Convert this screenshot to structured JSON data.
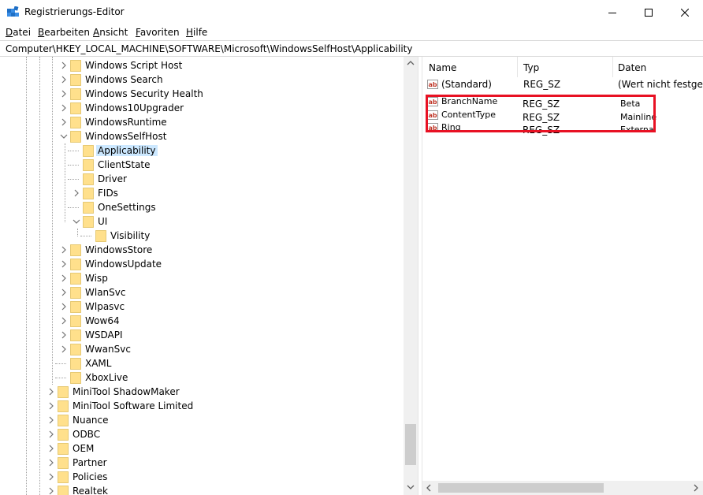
{
  "window": {
    "title": "Registrierungs-Editor"
  },
  "menu": {
    "items": [
      {
        "label": "Datei",
        "mnemonic": "D",
        "rest": "atei"
      },
      {
        "label": "Bearbeiten",
        "mnemonic": "B",
        "rest": "earbeiten"
      },
      {
        "label": "Ansicht",
        "mnemonic": "A",
        "rest": "nsicht"
      },
      {
        "label": "Favoriten",
        "mnemonic": "F",
        "rest": "avoriten"
      },
      {
        "label": "Hilfe",
        "mnemonic": "H",
        "rest": "ilfe"
      }
    ]
  },
  "address": {
    "path": "Computer\\HKEY_LOCAL_MACHINE\\SOFTWARE\\Microsoft\\WindowsSelfHost\\Applicability"
  },
  "tree": {
    "items": [
      {
        "label": "Windows Script Host",
        "expandable": true,
        "expanded": false,
        "level": 1
      },
      {
        "label": "Windows Search",
        "expandable": true,
        "expanded": false,
        "level": 1
      },
      {
        "label": "Windows Security Health",
        "expandable": true,
        "expanded": false,
        "level": 1
      },
      {
        "label": "Windows10Upgrader",
        "expandable": true,
        "expanded": false,
        "level": 1
      },
      {
        "label": "WindowsRuntime",
        "expandable": true,
        "expanded": false,
        "level": 1
      },
      {
        "label": "WindowsSelfHost",
        "expandable": true,
        "expanded": true,
        "level": 1
      },
      {
        "label": "Applicability",
        "expandable": false,
        "expanded": false,
        "level": 2,
        "selected": true
      },
      {
        "label": "ClientState",
        "expandable": false,
        "expanded": false,
        "level": 2
      },
      {
        "label": "Driver",
        "expandable": false,
        "expanded": false,
        "level": 2
      },
      {
        "label": "FIDs",
        "expandable": true,
        "expanded": false,
        "level": 2
      },
      {
        "label": "OneSettings",
        "expandable": false,
        "expanded": false,
        "level": 2
      },
      {
        "label": "UI",
        "expandable": true,
        "expanded": true,
        "level": 2
      },
      {
        "label": "Visibility",
        "expandable": false,
        "expanded": false,
        "level": 3
      },
      {
        "label": "WindowsStore",
        "expandable": true,
        "expanded": false,
        "level": 1
      },
      {
        "label": "WindowsUpdate",
        "expandable": true,
        "expanded": false,
        "level": 1
      },
      {
        "label": "Wisp",
        "expandable": true,
        "expanded": false,
        "level": 1
      },
      {
        "label": "WlanSvc",
        "expandable": true,
        "expanded": false,
        "level": 1
      },
      {
        "label": "Wlpasvc",
        "expandable": true,
        "expanded": false,
        "level": 1
      },
      {
        "label": "Wow64",
        "expandable": true,
        "expanded": false,
        "level": 1
      },
      {
        "label": "WSDAPI",
        "expandable": true,
        "expanded": false,
        "level": 1
      },
      {
        "label": "WwanSvc",
        "expandable": true,
        "expanded": false,
        "level": 1
      },
      {
        "label": "XAML",
        "expandable": false,
        "expanded": false,
        "level": 1
      },
      {
        "label": "XboxLive",
        "expandable": false,
        "expanded": false,
        "level": 1
      },
      {
        "label": "MiniTool ShadowMaker",
        "expandable": true,
        "expanded": false,
        "level": 0
      },
      {
        "label": "MiniTool Software Limited",
        "expandable": true,
        "expanded": false,
        "level": 0
      },
      {
        "label": "Nuance",
        "expandable": true,
        "expanded": false,
        "level": 0
      },
      {
        "label": "ODBC",
        "expandable": true,
        "expanded": false,
        "level": 0
      },
      {
        "label": "OEM",
        "expandable": true,
        "expanded": false,
        "level": 0
      },
      {
        "label": "Partner",
        "expandable": true,
        "expanded": false,
        "level": 0
      },
      {
        "label": "Policies",
        "expandable": true,
        "expanded": false,
        "level": 0
      },
      {
        "label": "Realtek",
        "expandable": true,
        "expanded": false,
        "level": 0
      }
    ]
  },
  "list": {
    "columns": {
      "name": "Name",
      "type": "Typ",
      "data": "Daten"
    },
    "rows": [
      {
        "name": "(Standard)",
        "type": "REG_SZ",
        "data": "(Wert nicht festgelegt)"
      },
      {
        "name": "BranchName",
        "type": "REG_SZ",
        "data": "Beta"
      },
      {
        "name": "ContentType",
        "type": "REG_SZ",
        "data": "Mainline"
      },
      {
        "name": "Ring",
        "type": "REG_SZ",
        "data": "External"
      }
    ]
  },
  "colors": {
    "highlight_box": "#e81123",
    "selection": "#cce8ff",
    "folder": "#ffe08c",
    "reg_icon_red": "#c0392b"
  }
}
